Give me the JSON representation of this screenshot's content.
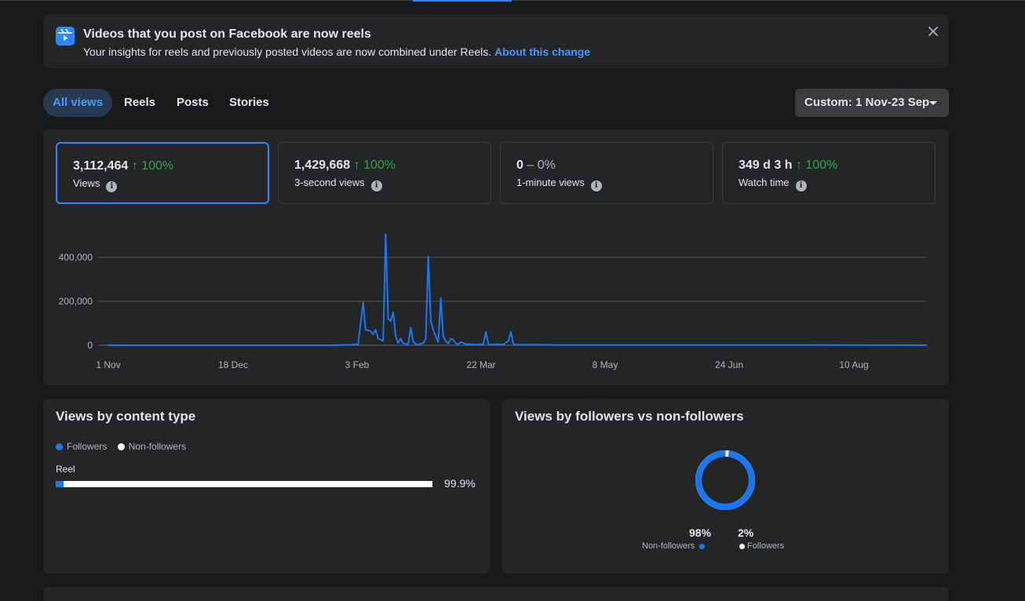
{
  "notice": {
    "title": "Videos that you post on Facebook are now reels",
    "text": "Your insights for reels and previously posted videos are now combined under Reels.",
    "link": "About this change"
  },
  "tabs": [
    "All views",
    "Reels",
    "Posts",
    "Stories"
  ],
  "date_range": "Custom: 1 Nov-23 Sep",
  "metrics": [
    {
      "value": "3,112,464",
      "change": "↑ 100%",
      "label": "Views"
    },
    {
      "value": "1,429,668",
      "change": "↑ 100%",
      "label": "3-second views"
    },
    {
      "value": "0",
      "change": "– 0%",
      "label": "1-minute views"
    },
    {
      "value": "349 d 3 h",
      "change": "↑ 100%",
      "label": "Watch time"
    }
  ],
  "colors": {
    "accent": "#2d88ff",
    "positive": "#31a24c",
    "series": "#1877f2",
    "followers": "#1877f2",
    "non_followers": "#ffffff"
  },
  "chart_data": {
    "type": "line",
    "x_ticks": [
      "1 Nov",
      "18 Dec",
      "3 Feb",
      "22 Mar",
      "8 May",
      "24 Jun",
      "10 Aug"
    ],
    "y_ticks": [
      0,
      200000,
      400000
    ],
    "y_tick_labels": [
      "0",
      "200,000",
      "400,000"
    ],
    "ylim": [
      0,
      500000
    ],
    "grid": true,
    "series": [
      {
        "values": [
          [
            0,
            0
          ],
          [
            90,
            0
          ],
          [
            97,
            2000
          ],
          [
            100,
            5000
          ],
          [
            102,
            195000
          ],
          [
            103,
            70000
          ],
          [
            105,
            65000
          ],
          [
            106,
            50000
          ],
          [
            107,
            70000
          ],
          [
            108,
            30000
          ],
          [
            110,
            20000
          ],
          [
            111,
            505000
          ],
          [
            112,
            120000
          ],
          [
            113,
            110000
          ],
          [
            114,
            150000
          ],
          [
            115,
            40000
          ],
          [
            116,
            10000
          ],
          [
            117,
            30000
          ],
          [
            118,
            8000
          ],
          [
            120,
            5000
          ],
          [
            121,
            80000
          ],
          [
            122,
            15000
          ],
          [
            123,
            5000
          ],
          [
            124,
            3000
          ],
          [
            126,
            10000
          ],
          [
            127,
            30000
          ],
          [
            128,
            405000
          ],
          [
            129,
            110000
          ],
          [
            130,
            70000
          ],
          [
            131,
            40000
          ],
          [
            132,
            15000
          ],
          [
            133,
            215000
          ],
          [
            134,
            40000
          ],
          [
            135,
            20000
          ],
          [
            136,
            8000
          ],
          [
            137,
            30000
          ],
          [
            138,
            25000
          ],
          [
            139,
            8000
          ],
          [
            140,
            5000
          ],
          [
            141,
            15000
          ],
          [
            142,
            10000
          ],
          [
            143,
            5000
          ],
          [
            144,
            5000
          ],
          [
            147,
            3000
          ],
          [
            150,
            5000
          ],
          [
            151,
            60000
          ],
          [
            152,
            5000
          ],
          [
            153,
            3000
          ],
          [
            156,
            5000
          ],
          [
            158,
            3000
          ],
          [
            160,
            20000
          ],
          [
            161,
            60000
          ],
          [
            162,
            5000
          ],
          [
            163,
            3000
          ],
          [
            166,
            2000
          ],
          [
            170,
            3000
          ],
          [
            180,
            1000
          ],
          [
            200,
            1000
          ],
          [
            240,
            1000
          ],
          [
            280,
            1000
          ],
          [
            320,
            500
          ],
          [
            327,
            0
          ]
        ]
      }
    ]
  },
  "content_type": {
    "title": "Views by content type",
    "legend": [
      "Followers",
      "Non-followers"
    ],
    "bars": [
      {
        "label": "Reel",
        "followers_fraction": 0.02,
        "pct_label": "99.9%"
      }
    ]
  },
  "followers_split": {
    "title": "Views by followers vs non-followers",
    "non_followers_pct": "98%",
    "followers_pct": "2%",
    "non_followers_label": "Non-followers",
    "followers_label": "Followers",
    "non_followers_value": 98,
    "followers_value": 2
  }
}
